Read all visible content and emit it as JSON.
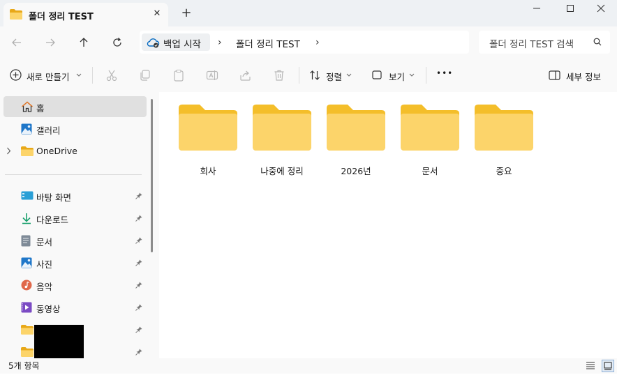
{
  "window": {
    "tab_title": "폴더 정리 TEST",
    "new_tab": "+",
    "tab_close": "✕"
  },
  "address": {
    "crumbs": [
      "백업 시작",
      "폴더 정리 TEST"
    ],
    "separator": "›",
    "search_placeholder": "폴더 정리 TEST 검색"
  },
  "toolbar": {
    "new_label": "새로 만들기",
    "sort_label": "정렬",
    "view_label": "보기",
    "more_label": "•••",
    "details_label": "세부 정보"
  },
  "sidebar": {
    "items": [
      {
        "label": "홈"
      },
      {
        "label": "갤러리"
      },
      {
        "label": "OneDrive"
      },
      {
        "label": "바탕 화면"
      },
      {
        "label": "다운로드"
      },
      {
        "label": "문서"
      },
      {
        "label": "사진"
      },
      {
        "label": "음악"
      },
      {
        "label": "동영상"
      },
      {
        "label": ""
      },
      {
        "label": ""
      }
    ]
  },
  "content": {
    "folders": [
      {
        "name": "회사"
      },
      {
        "name": "나중에 정리"
      },
      {
        "name": "2026년"
      },
      {
        "name": "문서"
      },
      {
        "name": "중요"
      }
    ]
  },
  "status": {
    "count_text": "5개 항목"
  },
  "colors": {
    "folder_back": "#f4be2a",
    "folder_front": "#fcd46a",
    "accent": "#0067c0"
  }
}
